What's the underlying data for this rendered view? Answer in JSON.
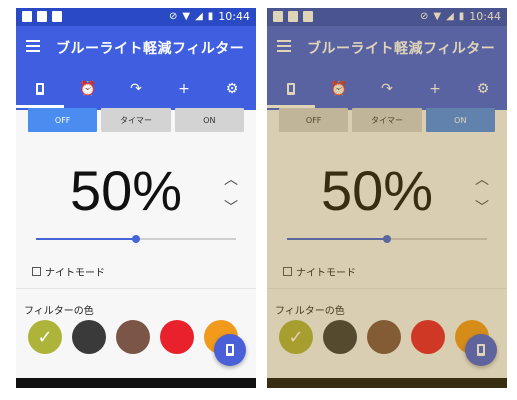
{
  "app": {
    "title": "ブルーライト軽減フィルター",
    "status_time": "10:44",
    "tabs": [
      "phone-icon",
      "alarm-icon",
      "redo-icon",
      "plus-icon",
      "gear-icon"
    ],
    "buttons": [
      "OFF",
      "タイマー",
      "ON"
    ],
    "percent_label": "50%",
    "percent_value": 50,
    "night_mode_label": "ナイトモード",
    "filter_colors_label": "フィルターの色",
    "swatch_colors": [
      "#aeb43a",
      "#3a3a3a",
      "#7b5546",
      "#e8212d",
      "#f19a1b"
    ],
    "selected_swatch": 0
  },
  "screens": [
    {
      "selected_button": 0,
      "filter_on": false
    },
    {
      "selected_button": 2,
      "filter_on": true
    }
  ]
}
